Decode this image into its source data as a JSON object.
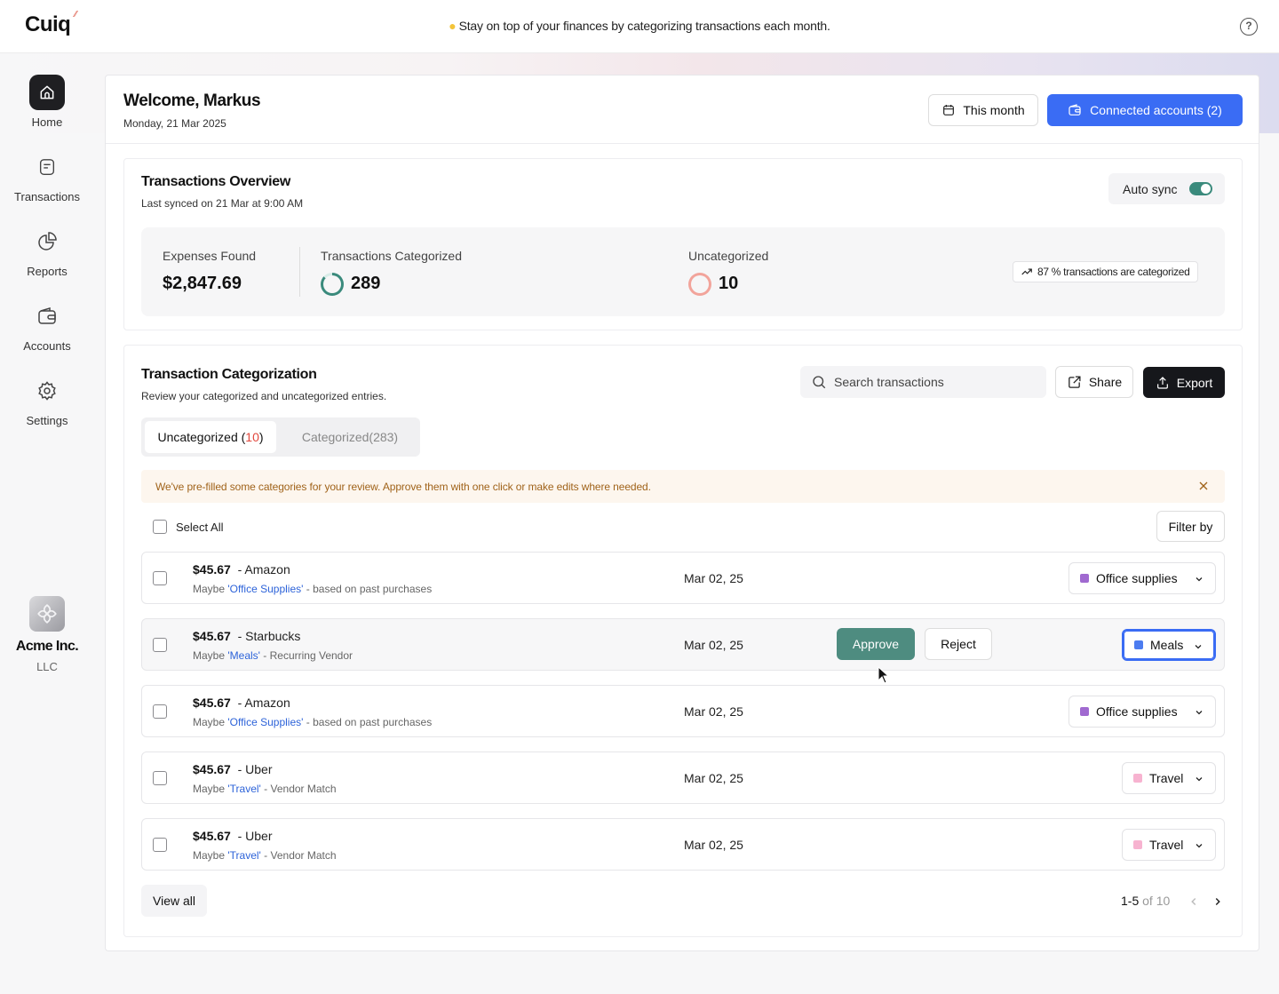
{
  "app": {
    "logo": "Cuiq"
  },
  "topbar": {
    "tip": "Stay on top of your finances by categorizing transactions each month."
  },
  "sidebar": {
    "items": [
      {
        "label": "Home",
        "icon": "home-icon",
        "active": true
      },
      {
        "label": "Transactions",
        "icon": "document-icon",
        "active": false
      },
      {
        "label": "Reports",
        "icon": "pie-chart-icon",
        "active": false
      },
      {
        "label": "Accounts",
        "icon": "wallet-icon",
        "active": false
      },
      {
        "label": "Settings",
        "icon": "gear-icon",
        "active": false
      }
    ],
    "company": {
      "name": "Acme Inc.",
      "type": "LLC"
    }
  },
  "header": {
    "welcome": "Welcome, Markus",
    "date": "Monday, 21 Mar 2025",
    "period_button": "This month",
    "accounts_button": "Connected accounts (2)"
  },
  "overview": {
    "title": "Transactions Overview",
    "last_synced": "Last synced on 21 Mar at 9:00 AM",
    "auto_sync_label": "Auto sync",
    "auto_sync_on": true,
    "expenses_label": "Expenses Found",
    "expenses_value": "$2,847.69",
    "categorized_label": "Transactions Categorized",
    "categorized_value": "289",
    "uncategorized_label": "Uncategorized",
    "uncategorized_value": "10",
    "percent_badge": "87 % transactions are categorized"
  },
  "categorization": {
    "title": "Transaction Categorization",
    "subtitle": "Review your categorized and uncategorized entries.",
    "search_placeholder": "Search transactions",
    "share_label": "Share",
    "export_label": "Export",
    "tab_uncategorized_label": "Uncategorized (",
    "tab_uncategorized_count": "10",
    "tab_uncategorized_close": ")",
    "tab_categorized_label": "Categorized",
    "tab_categorized_count": "(283)",
    "notice": "We've pre-filled some categories for your review. Approve them with one click or make edits where needed.",
    "select_all_label": "Select All",
    "filter_label": "Filter by",
    "approve_label": "Approve",
    "reject_label": "Reject",
    "rows": [
      {
        "amount": "$45.67",
        "vendor": "- Amazon",
        "maybe": "Maybe ",
        "category_link": "'Office Supplies'",
        "reason": " - based on past purchases",
        "date": "Mar 02, 25",
        "category": "Office supplies",
        "color": "#a06ad0"
      },
      {
        "amount": "$45.67",
        "vendor": "- Starbucks",
        "maybe": "Maybe ",
        "category_link": "'Meals'",
        "reason": " - Recurring Vendor",
        "date": "Mar 02, 25",
        "category": "Meals",
        "color": "#4c7cf0"
      },
      {
        "amount": "$45.67",
        "vendor": "- Amazon",
        "maybe": "Maybe ",
        "category_link": "'Office Supplies'",
        "reason": " - based on past purchases",
        "date": "Mar 02, 25",
        "category": "Office supplies",
        "color": "#a06ad0"
      },
      {
        "amount": "$45.67",
        "vendor": "- Uber",
        "maybe": "Maybe ",
        "category_link": "'Travel'",
        "reason": " - Vendor Match",
        "date": "Mar 02, 25",
        "category": "Travel",
        "color": "#f7b3d0"
      },
      {
        "amount": "$45.67",
        "vendor": "- Uber",
        "maybe": "Maybe ",
        "category_link": "'Travel'",
        "reason": " - Vendor Match",
        "date": "Mar 02, 25",
        "category": "Travel",
        "color": "#f7b3d0"
      }
    ],
    "view_all_label": "View all",
    "pagination_range": "1-5",
    "pagination_total": " of 10"
  },
  "colors": {
    "accent": "#3a6cf4",
    "approve": "#4e8c80",
    "toggle": "#3a8a7c",
    "notice_text": "#a0631a"
  }
}
